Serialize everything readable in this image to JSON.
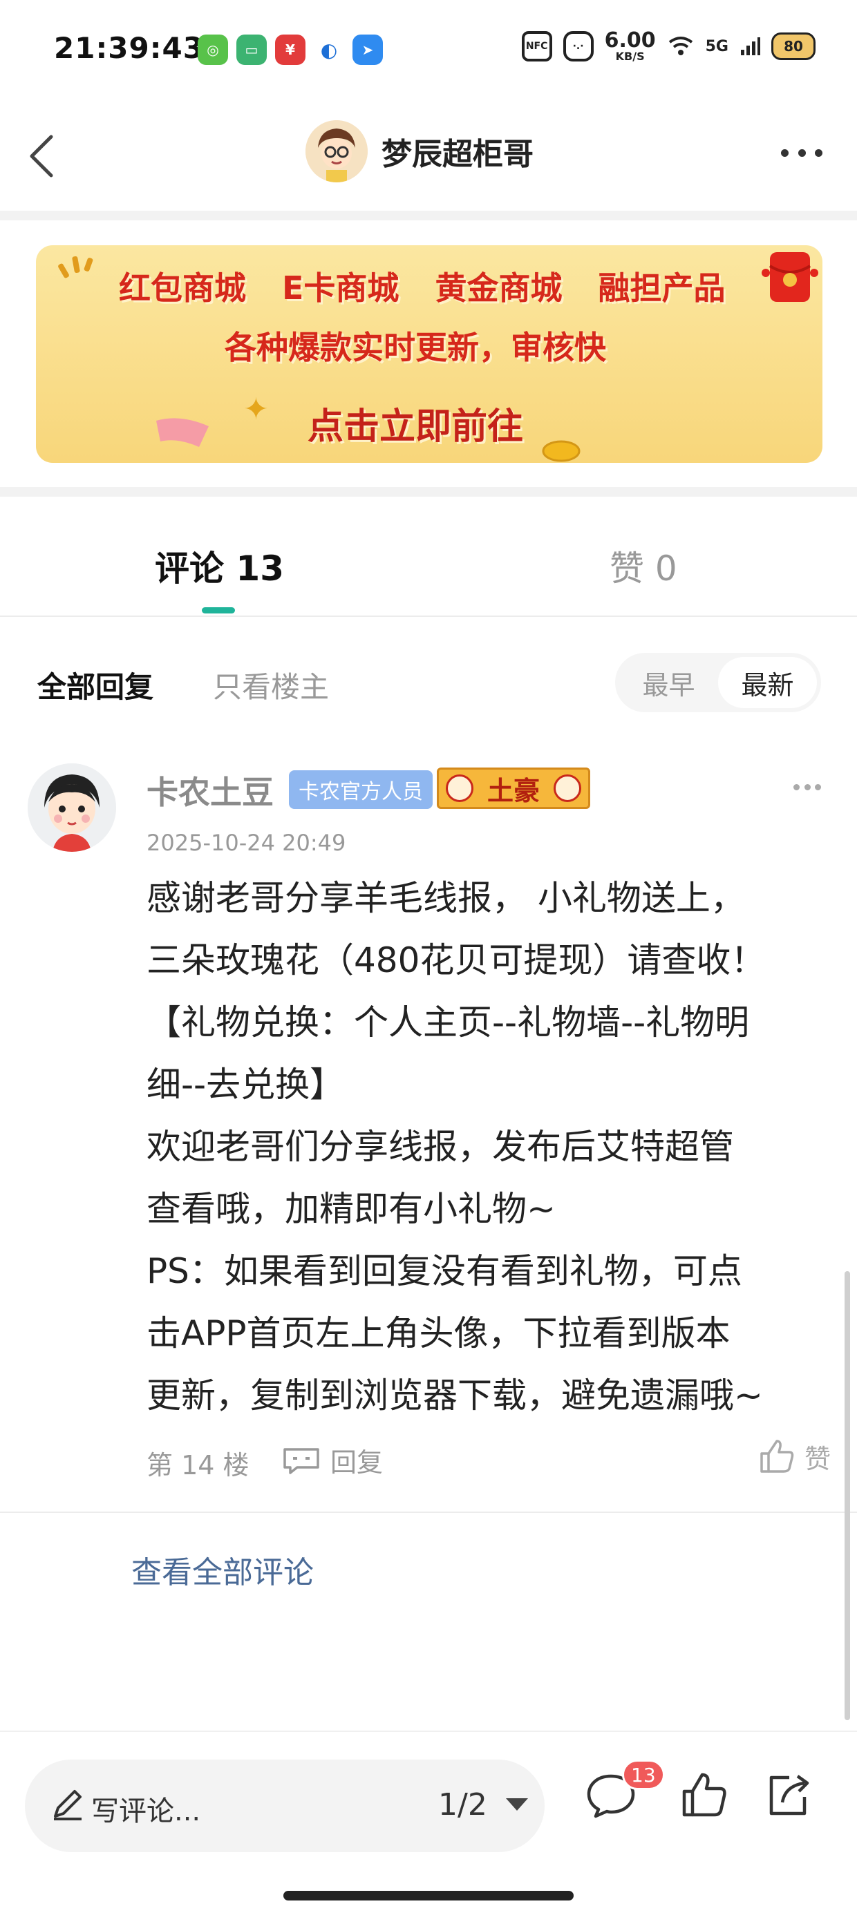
{
  "status_bar": {
    "time": "21:39:43",
    "net_speed_value": "6.00",
    "net_speed_unit": "KB/S",
    "signal_label": "5G",
    "battery": "80",
    "nfc_label": "NFC"
  },
  "header": {
    "title": "梦辰超柜哥"
  },
  "banner": {
    "row1": [
      "红包商城",
      "E卡商城",
      "黄金商城",
      "融担产品"
    ],
    "row2": "各种爆款实时更新，审核快",
    "row3": "点击立即前往"
  },
  "tabs": {
    "comments_label": "评论",
    "comments_count": "13",
    "likes_label": "赞",
    "likes_count": "0"
  },
  "filter": {
    "all": "全部回复",
    "op_only": "只看楼主",
    "sort_earliest": "最早",
    "sort_latest": "最新"
  },
  "comment": {
    "author": "卡农土豆",
    "badge": "卡农官方人员",
    "rich_badge": "土豪",
    "time": "2025-10-24 20:49",
    "lines": [
      "感谢老哥分享羊毛线报， 小礼物送上，",
      "三朵玫瑰花（480花贝可提现）请查收！",
      "【礼物兑换：个人主页--礼物墙--礼物明",
      "细--去兑换】",
      "欢迎老哥们分享线报，发布后艾特超管",
      "查看哦，加精即有小礼物~",
      "PS：如果看到回复没有看到礼物，可点",
      "击APP首页左上角头像，下拉看到版本",
      "更新，复制到浏览器下载，避免遗漏哦~"
    ],
    "floor": "第 14 楼",
    "reply": "回复",
    "like": "赞"
  },
  "view_all": "查看全部评论",
  "bottom_bar": {
    "write_placeholder": "写评论...",
    "page_indicator": "1/2",
    "comment_badge": "13"
  },
  "colors": {
    "accent_green": "#1fb49a",
    "banner_red": "#d6281b",
    "link_blue": "#4a6a96",
    "badge_blue": "#8fb7f0",
    "notify_red": "#f05a5a"
  }
}
